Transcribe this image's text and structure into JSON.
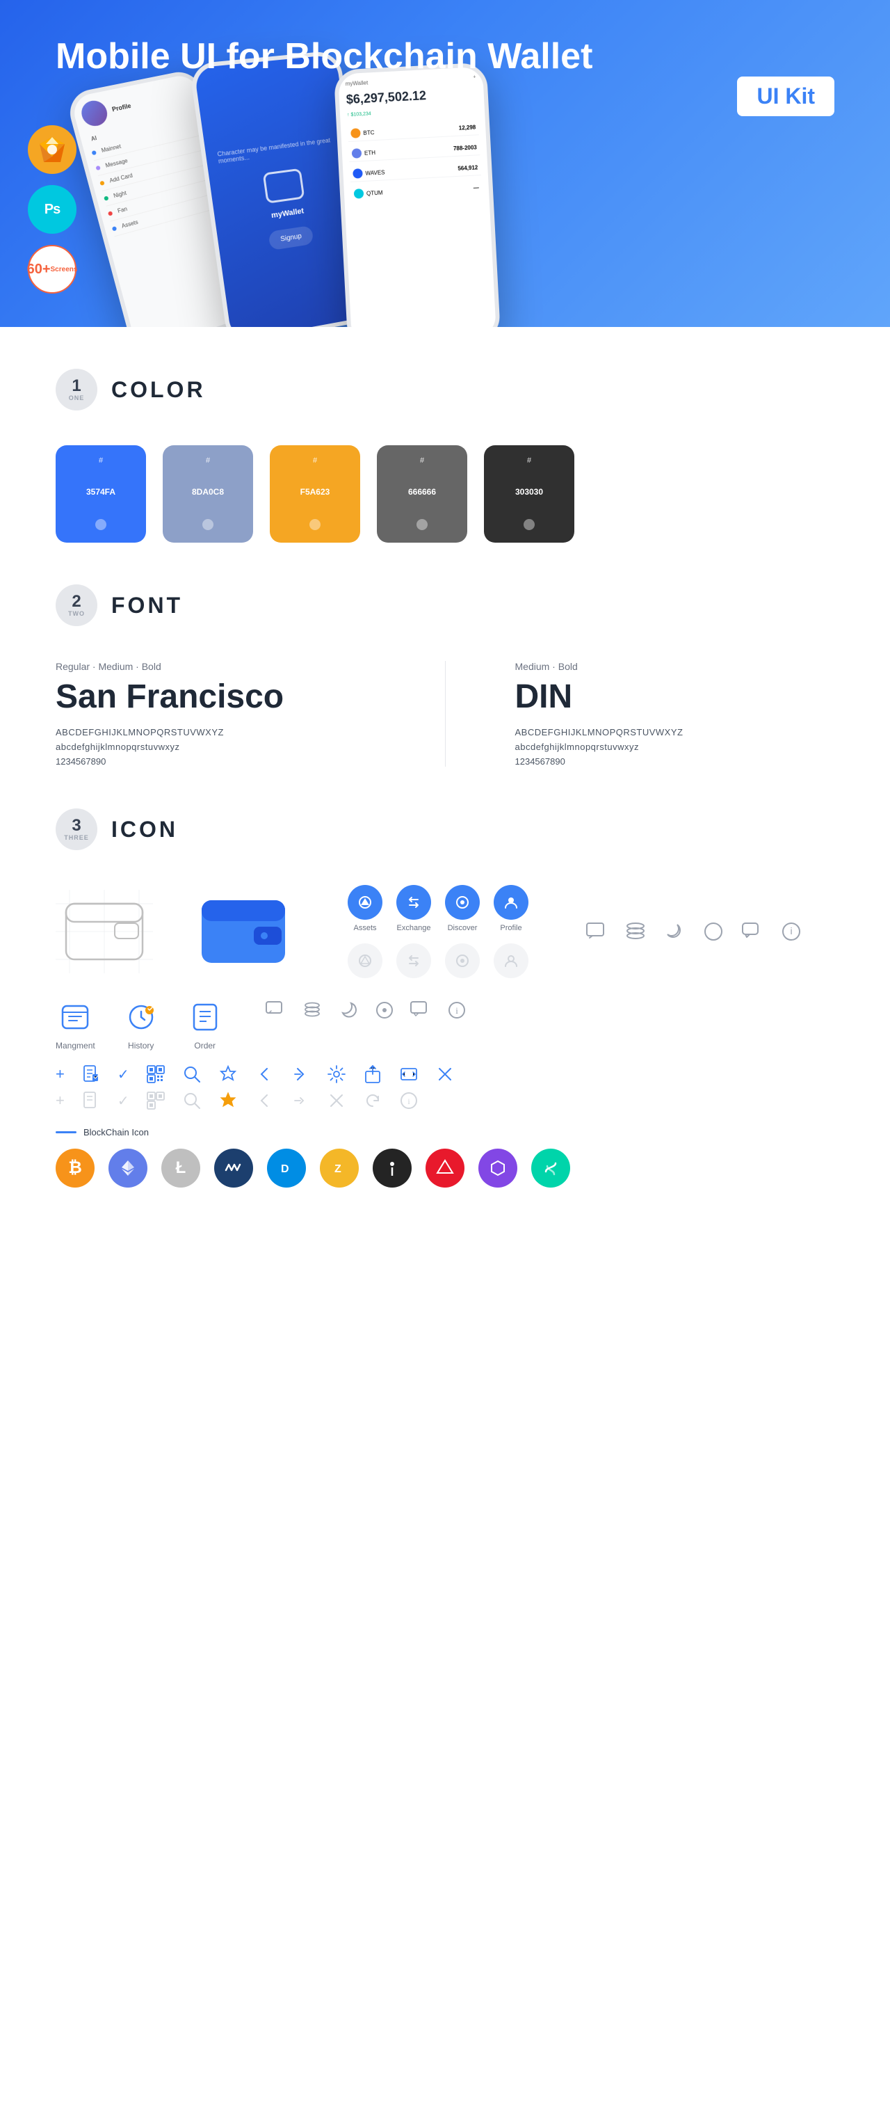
{
  "hero": {
    "title_regular": "Mobile UI for Blockchain ",
    "title_bold": "Wallet",
    "badge": "UI Kit",
    "tools": [
      {
        "name": "Sketch",
        "symbol": "⬡"
      },
      {
        "name": "Photoshop",
        "symbol": "Ps"
      },
      {
        "name": "screens",
        "count": "60+"
      }
    ]
  },
  "sections": {
    "color": {
      "number": "1",
      "word": "ONE",
      "title": "COLOR",
      "swatches": [
        {
          "hex": "#3574FA",
          "label": "#\n3574FA"
        },
        {
          "hex": "#8DA0C8",
          "label": "#\n8DA0C8"
        },
        {
          "hex": "#F5A623",
          "label": "#\nF5A623"
        },
        {
          "hex": "#666666",
          "label": "#\n666666"
        },
        {
          "hex": "#303030",
          "label": "#\n303030"
        }
      ]
    },
    "font": {
      "number": "2",
      "word": "TWO",
      "title": "FONT",
      "fonts": [
        {
          "style_label": "Regular · Medium · Bold",
          "name": "San Francisco",
          "alphabet_upper": "ABCDEFGHIJKLMNOPQRSTUVWXYZ",
          "alphabet_lower": "abcdefghijklmnopqrstuvwxyz",
          "numbers": "1234567890"
        },
        {
          "style_label": "Medium · Bold",
          "name": "DIN",
          "alphabet_upper": "ABCDEFGHIJKLMNOPQRSTUVWXYZ",
          "alphabet_lower": "abcdefghijklmnopqrstuvwxyz",
          "numbers": "1234567890"
        }
      ]
    },
    "icon": {
      "number": "3",
      "word": "THREE",
      "title": "ICON",
      "nav_labels": [
        "Assets",
        "Exchange",
        "Discover",
        "Profile"
      ],
      "bottom_labels": [
        "Mangment",
        "History",
        "Order"
      ],
      "blockchain_label": "BlockChain Icon",
      "crypto_names": [
        "Bitcoin",
        "Ethereum",
        "Litecoin",
        "Waves",
        "Dash",
        "Zcash",
        "IOTA",
        "Ark",
        "Matic",
        "Skycoin"
      ]
    }
  }
}
